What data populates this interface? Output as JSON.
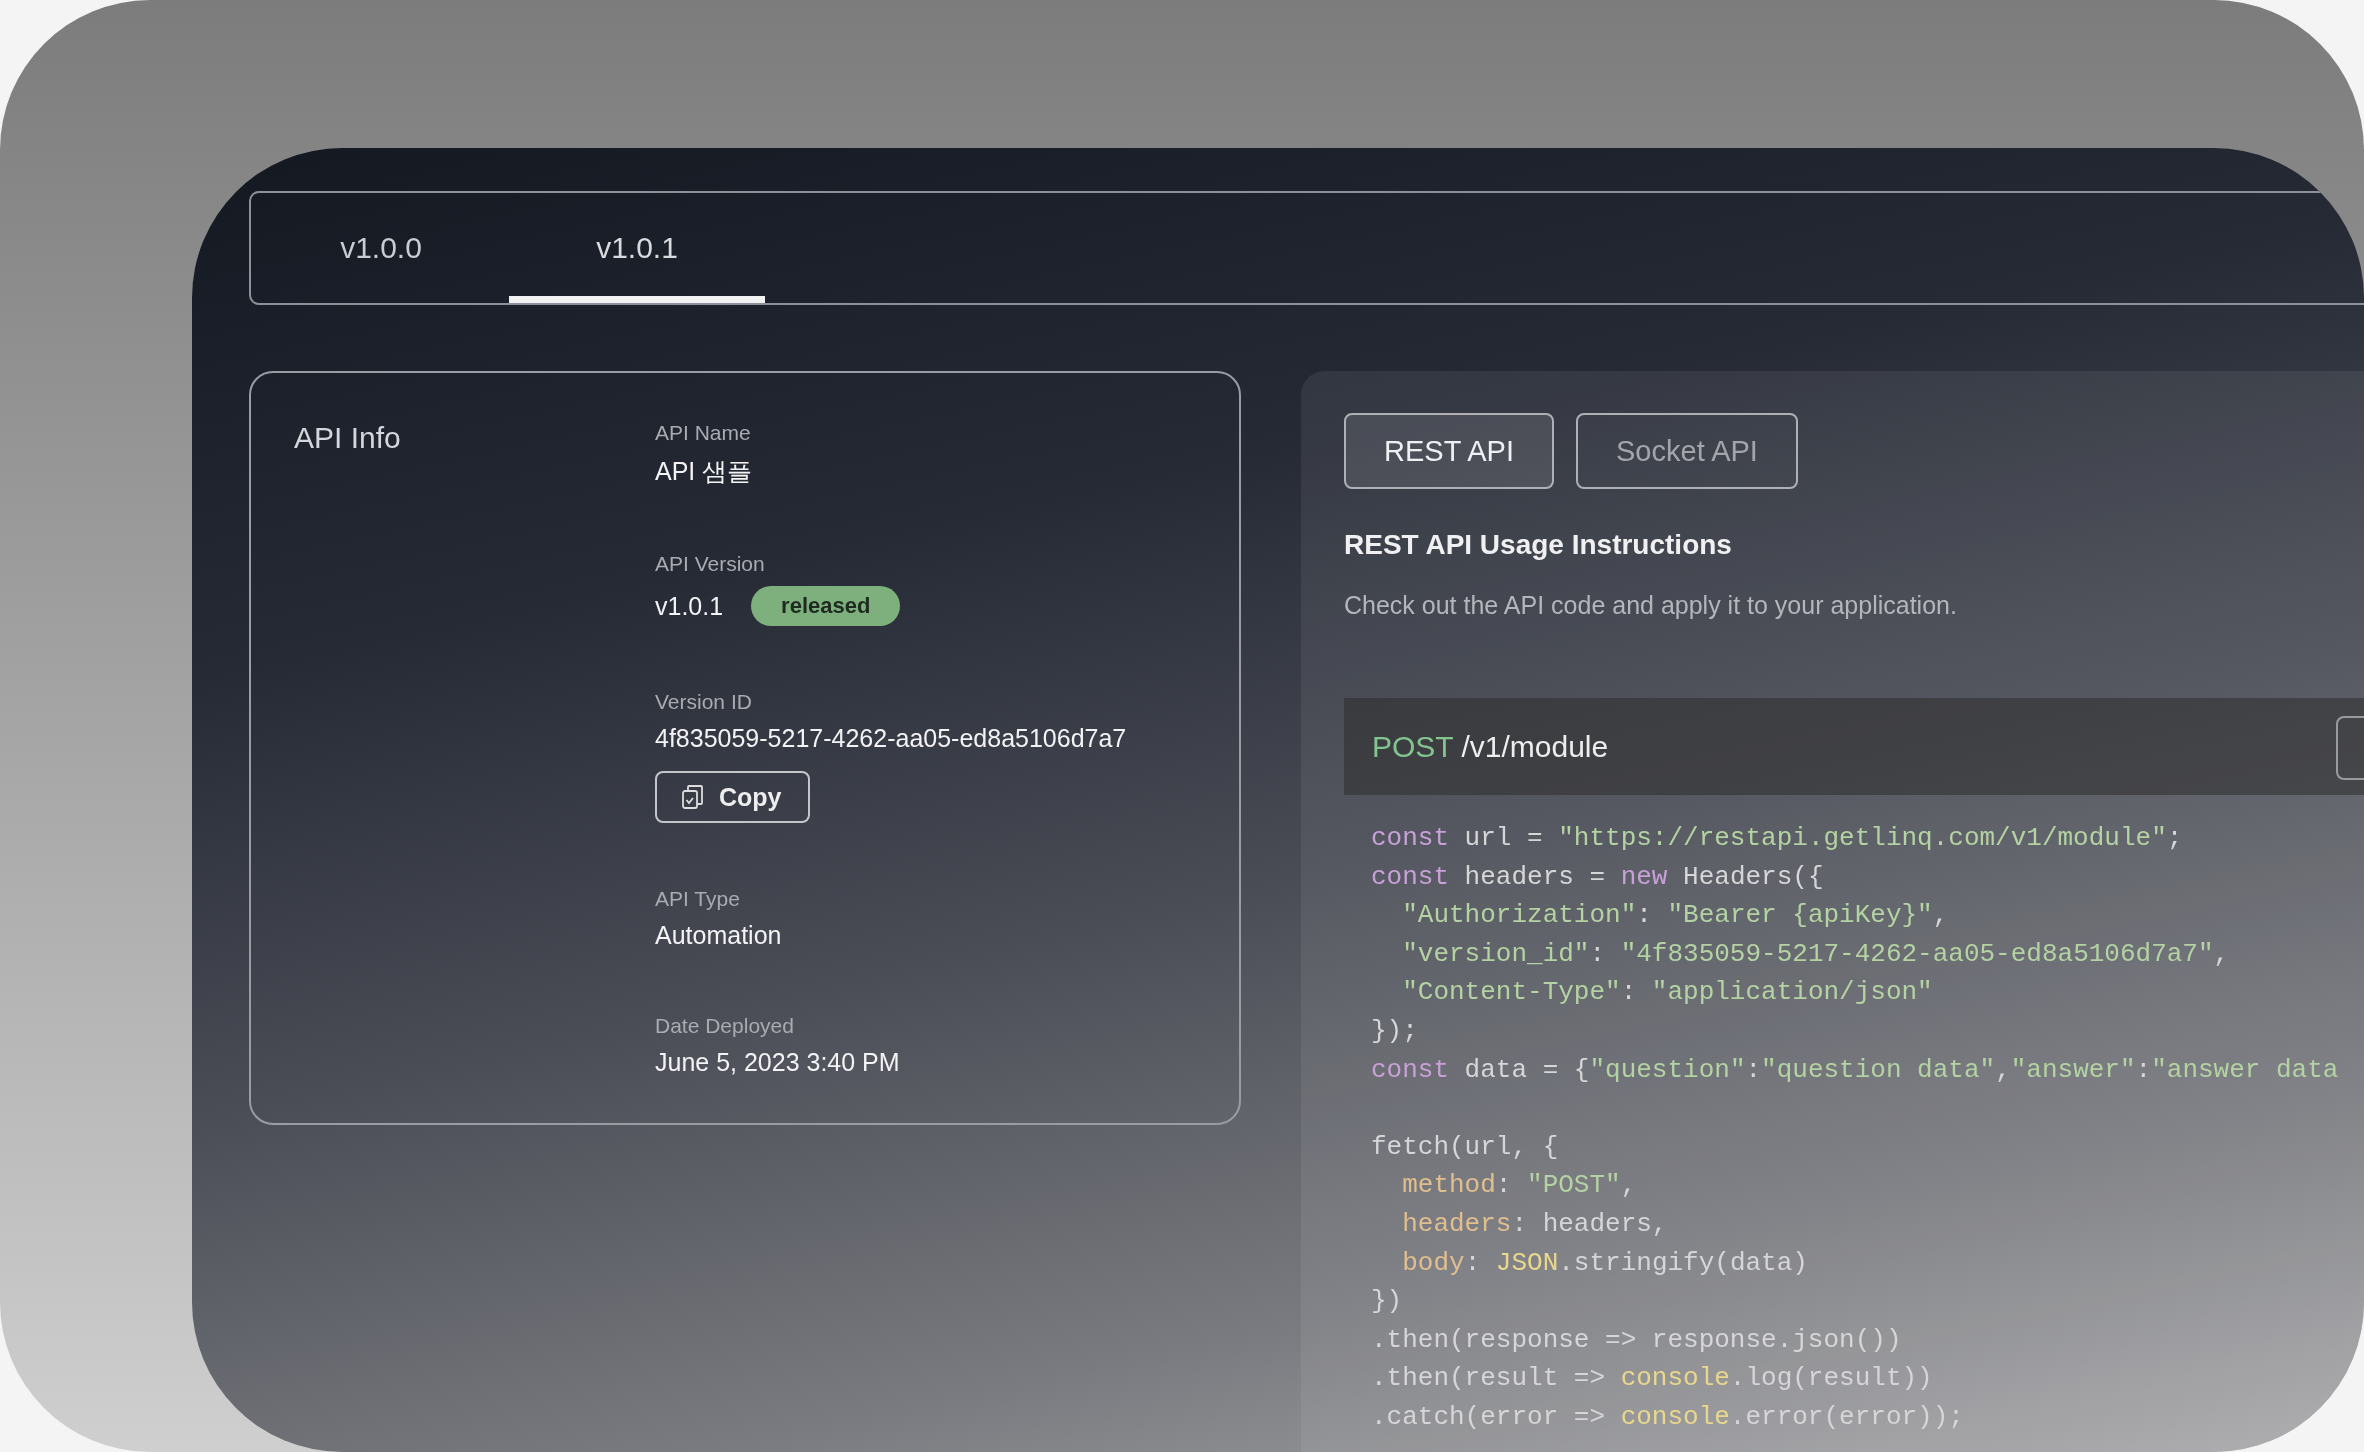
{
  "version_tabs": [
    {
      "label": "v1.0.0",
      "selected": false
    },
    {
      "label": "v1.0.1",
      "selected": true
    }
  ],
  "api_info": {
    "title": "API Info",
    "fields": [
      {
        "label": "API Name",
        "value": "API 샘플"
      },
      {
        "label": "API Version",
        "value": "v1.0.1",
        "badge": "released"
      },
      {
        "label": "Version ID",
        "value": "4f835059-5217-4262-aa05-ed8a5106d7a7",
        "action": "Copy"
      },
      {
        "label": "API Type",
        "value": "Automation"
      },
      {
        "label": "Date Deployed",
        "value": "June 5, 2023 3:40 PM"
      }
    ]
  },
  "usage": {
    "api_tabs": [
      {
        "label": "REST API",
        "selected": true
      },
      {
        "label": "Socket API",
        "selected": false
      }
    ],
    "heading": "REST API Usage Instructions",
    "description": "Check out the API code and apply it to your application.",
    "endpoint": {
      "method": "POST",
      "path": "/v1/module"
    },
    "code_blocks": [
      [
        [
          {
            "kind": "keyword",
            "text": "const"
          },
          {
            "kind": "plain",
            "text": " url = "
          },
          {
            "kind": "string",
            "text": "\"https://restapi.getlinq.com/v1/module\""
          },
          {
            "kind": "plain",
            "text": ";"
          }
        ],
        [
          {
            "kind": "keyword",
            "text": "const"
          },
          {
            "kind": "plain",
            "text": " headers = "
          },
          {
            "kind": "keyword",
            "text": "new"
          },
          {
            "kind": "plain",
            "text": " Headers({"
          }
        ],
        [
          {
            "kind": "string",
            "text": "  \"Authorization\""
          },
          {
            "kind": "plain",
            "text": ": "
          },
          {
            "kind": "string",
            "text": "\"Bearer {apiKey}\""
          },
          {
            "kind": "plain",
            "text": ","
          }
        ],
        [
          {
            "kind": "string",
            "text": "  \"version_id\""
          },
          {
            "kind": "plain",
            "text": ": "
          },
          {
            "kind": "string",
            "text": "\"4f835059-5217-4262-aa05-ed8a5106d7a7\""
          },
          {
            "kind": "plain",
            "text": ","
          }
        ],
        [
          {
            "kind": "string",
            "text": "  \"Content-Type\""
          },
          {
            "kind": "plain",
            "text": ": "
          },
          {
            "kind": "string",
            "text": "\"application/json\""
          }
        ],
        [
          {
            "kind": "plain",
            "text": "});"
          }
        ],
        [
          {
            "kind": "keyword",
            "text": "const"
          },
          {
            "kind": "plain",
            "text": " data = {"
          },
          {
            "kind": "string",
            "text": "\"question\""
          },
          {
            "kind": "plain",
            "text": ":"
          },
          {
            "kind": "string",
            "text": "\"question data\""
          },
          {
            "kind": "plain",
            "text": ","
          },
          {
            "kind": "string",
            "text": "\"answer\""
          },
          {
            "kind": "plain",
            "text": ":"
          },
          {
            "kind": "string",
            "text": "\"answer data"
          }
        ]
      ],
      [
        [
          {
            "kind": "plain",
            "text": "fetch(url, {"
          }
        ],
        [
          {
            "kind": "property",
            "text": "  method"
          },
          {
            "kind": "plain",
            "text": ": "
          },
          {
            "kind": "string",
            "text": "\"POST\""
          },
          {
            "kind": "plain",
            "text": ","
          }
        ],
        [
          {
            "kind": "property",
            "text": "  headers"
          },
          {
            "kind": "plain",
            "text": ": headers,"
          }
        ],
        [
          {
            "kind": "property",
            "text": "  body"
          },
          {
            "kind": "plain",
            "text": ": "
          },
          {
            "kind": "builtin",
            "text": "JSON"
          },
          {
            "kind": "plain",
            "text": ".stringify(data)"
          }
        ],
        [
          {
            "kind": "plain",
            "text": "})"
          }
        ],
        [
          {
            "kind": "plain",
            "text": ".then(response => response.json())"
          }
        ],
        [
          {
            "kind": "plain",
            "text": ".then(result => "
          },
          {
            "kind": "builtin",
            "text": "console"
          },
          {
            "kind": "plain",
            "text": ".log(result))"
          }
        ],
        [
          {
            "kind": "plain",
            "text": ".catch(error => "
          },
          {
            "kind": "builtin",
            "text": "console"
          },
          {
            "kind": "plain",
            "text": ".error(error));"
          }
        ]
      ]
    ]
  }
}
